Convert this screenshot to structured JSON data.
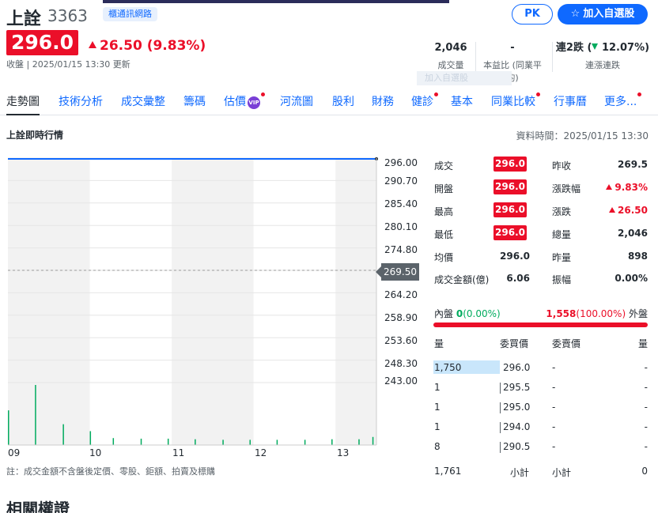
{
  "header": {
    "name": "上詮",
    "code": "3363",
    "tag": "櫃通訊網路",
    "price": "296.0",
    "change": "26.50 (9.83%)",
    "status": "收盤 | 2025/01/15 13:30 更新",
    "pk_label": "PK",
    "add_label": "加入自選股",
    "ghost_text": "加入自選股"
  },
  "stats": {
    "volume": {
      "value": "2,046",
      "label": "成交量"
    },
    "pe": {
      "value": "-",
      "label": "本益比 (同業平均)"
    },
    "streak": {
      "value_prefix": "連2跌 (",
      "value_pct": "12.07%",
      "value_suffix": ")",
      "label": "連漲連跌"
    }
  },
  "tabs": [
    {
      "label": "走勢圖",
      "active": true,
      "dot": false
    },
    {
      "label": "技術分析",
      "dot": false
    },
    {
      "label": "成交彙整",
      "dot": false
    },
    {
      "label": "籌碼",
      "dot": false
    },
    {
      "label": "估價",
      "dot": true,
      "vip": "VIP"
    },
    {
      "label": "河流圖",
      "dot": false
    },
    {
      "label": "股利",
      "dot": false
    },
    {
      "label": "財務",
      "dot": false
    },
    {
      "label": "健診",
      "dot": true
    },
    {
      "label": "基本",
      "dot": false
    },
    {
      "label": "同業比較",
      "dot": true
    },
    {
      "label": "行事曆",
      "dot": false
    },
    {
      "label": "更多...",
      "dot": true
    }
  ],
  "section": {
    "title": "上詮即時行情",
    "data_time": "資料時間：2025/01/15 13:30"
  },
  "chart_data": {
    "type": "line",
    "y_ticks": [
      "296.00",
      "290.70",
      "285.40",
      "280.10",
      "274.80",
      "269.50",
      "264.20",
      "258.90",
      "253.60",
      "248.30",
      "243.00"
    ],
    "ylim": [
      243.0,
      296.0
    ],
    "x_ticks": [
      "09",
      "10",
      "11",
      "12",
      "13"
    ],
    "prev_close": 269.5,
    "prev_close_label": "269.50",
    "price_line": [
      296.0,
      296.0
    ],
    "volume_bars": [
      {
        "t": 9.0,
        "v": 300
      },
      {
        "t": 9.33,
        "v": 520
      },
      {
        "t": 9.67,
        "v": 180
      },
      {
        "t": 10.0,
        "v": 120
      },
      {
        "t": 10.28,
        "v": 60
      },
      {
        "t": 10.62,
        "v": 55
      },
      {
        "t": 10.95,
        "v": 55
      },
      {
        "t": 11.28,
        "v": 50
      },
      {
        "t": 11.62,
        "v": 45
      },
      {
        "t": 11.95,
        "v": 45
      },
      {
        "t": 12.28,
        "v": 45
      },
      {
        "t": 12.62,
        "v": 45
      },
      {
        "t": 12.95,
        "v": 50
      },
      {
        "t": 13.28,
        "v": 50
      },
      {
        "t": 13.45,
        "v": 70
      }
    ],
    "x_range": [
      9.0,
      13.5
    ]
  },
  "note": "註：成交金額不含盤後定價、零股、鉅額、拍賣及標購",
  "quote": {
    "left": [
      {
        "label": "成交",
        "value": "296.0",
        "boxed": true
      },
      {
        "label": "開盤",
        "value": "296.0",
        "boxed": true
      },
      {
        "label": "最高",
        "value": "296.0",
        "boxed": true
      },
      {
        "label": "最低",
        "value": "296.0",
        "boxed": true
      },
      {
        "label": "均價",
        "value": "296.0",
        "boxed": false
      },
      {
        "label": "成交金額(億)",
        "value": "6.06",
        "boxed": false
      }
    ],
    "right": [
      {
        "label": "昨收",
        "value": "269.5",
        "up": false
      },
      {
        "label": "漲跌幅",
        "value": "9.83%",
        "up": true
      },
      {
        "label": "漲跌",
        "value": "26.50",
        "up": true
      },
      {
        "label": "總量",
        "value": "2,046",
        "up": false
      },
      {
        "label": "昨量",
        "value": "898",
        "up": false
      },
      {
        "label": "振幅",
        "value": "0.00%",
        "up": false
      }
    ]
  },
  "inout": {
    "in_label": "內盤",
    "in_value": "0",
    "in_pct": "(0.00%)",
    "out_value": "1,558",
    "out_pct": "(100.00%)",
    "out_label": "外盤"
  },
  "orderbook": {
    "headers": [
      "量",
      "委買價",
      "委賣價",
      "量"
    ],
    "rows": [
      {
        "bid_qty": "1,750",
        "bid_price": "296.0",
        "ask_price": "-",
        "ask_qty": "-"
      },
      {
        "bid_qty": "1",
        "bid_price": "295.5",
        "ask_price": "-",
        "ask_qty": "-"
      },
      {
        "bid_qty": "1",
        "bid_price": "295.0",
        "ask_price": "-",
        "ask_qty": "-"
      },
      {
        "bid_qty": "1",
        "bid_price": "294.0",
        "ask_price": "-",
        "ask_qty": "-"
      },
      {
        "bid_qty": "8",
        "bid_price": "290.5",
        "ask_price": "-",
        "ask_qty": "-"
      }
    ],
    "footer": {
      "bid_total": "1,761",
      "bid_label": "小計",
      "ask_label": "小計",
      "ask_total": "0"
    }
  },
  "related_title": "相關權證"
}
